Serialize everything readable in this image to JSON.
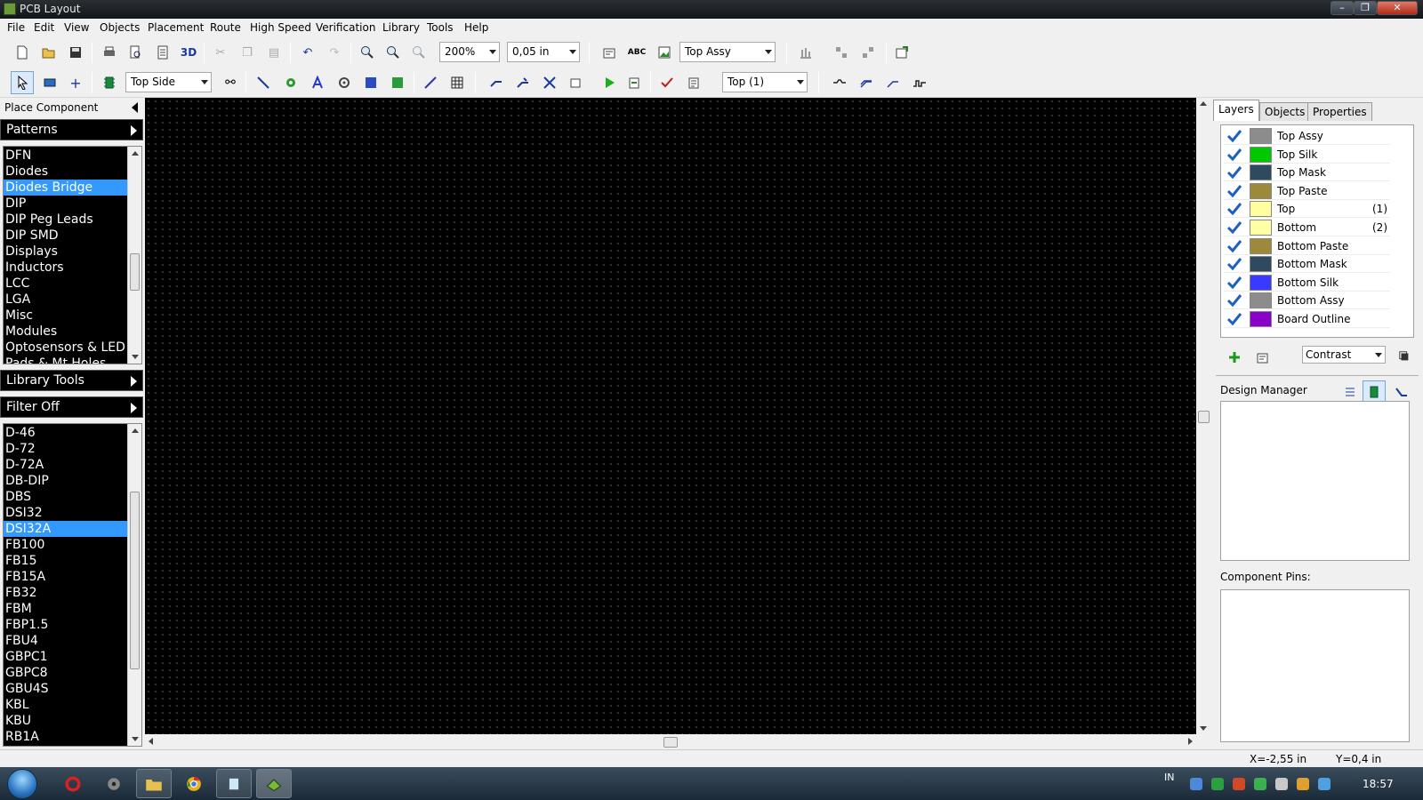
{
  "window": {
    "title": "PCB Layout",
    "min": "–",
    "max": "❐",
    "close": "✕"
  },
  "menu": [
    "File",
    "Edit",
    "View",
    "Objects",
    "Placement",
    "Route",
    "High Speed",
    "Verification",
    "Library",
    "Tools",
    "Help"
  ],
  "toolbar1": {
    "label_3d": "3D",
    "label_abc": "ABC",
    "zoom": "200%",
    "grid": "0,05 in",
    "layer": "Top Assy"
  },
  "toolbar2": {
    "side": "Top Side",
    "route_layer": "Top (1)"
  },
  "left_panel": {
    "place_component": "Place Component",
    "patterns_header": "Patterns",
    "patterns": [
      "DFN",
      "Diodes",
      "Diodes Bridge",
      "DIP",
      "DIP Peg Leads",
      "DIP SMD",
      "Displays",
      "Inductors",
      "LCC",
      "LGA",
      "Misc",
      "Modules",
      "Optosensors & LED",
      "Pads & Mt Holes"
    ],
    "patterns_selected": "Diodes Bridge",
    "library_tools": "Library Tools",
    "filter": "Filter Off",
    "components": [
      "D-46",
      "D-72",
      "D-72A",
      "DB-DIP",
      "DBS",
      "DSI32",
      "DSI32A",
      "FB100",
      "FB15",
      "FB15A",
      "FB32",
      "FBM",
      "FBP1.5",
      "FBU4",
      "GBPC1",
      "GBPC8",
      "GBU4S",
      "KBL",
      "KBU",
      "RB1A"
    ],
    "components_selected": "DSI32A"
  },
  "right_panel": {
    "tabs": [
      "Layers",
      "Objects",
      "Properties"
    ],
    "active_tab": "Layers",
    "layers": [
      {
        "name": "Top Assy",
        "color": "#8c8c8c",
        "num": ""
      },
      {
        "name": "Top Silk",
        "color": "#00c800",
        "num": ""
      },
      {
        "name": "Top Mask",
        "color": "#2e4a5e",
        "num": ""
      },
      {
        "name": "Top Paste",
        "color": "#9c8a3a",
        "num": ""
      },
      {
        "name": "Top",
        "color": "#ffff9e",
        "num": "(1)"
      },
      {
        "name": "Bottom",
        "color": "#ffffa8",
        "num": "(2)"
      },
      {
        "name": "Bottom Paste",
        "color": "#9c8a3a",
        "num": ""
      },
      {
        "name": "Bottom Mask",
        "color": "#2e4a5e",
        "num": ""
      },
      {
        "name": "Bottom Silk",
        "color": "#3a3aff",
        "num": ""
      },
      {
        "name": "Bottom Assy",
        "color": "#8c8c8c",
        "num": ""
      },
      {
        "name": "Board Outline",
        "color": "#8a00c8",
        "num": ""
      }
    ],
    "contrast": "Contrast",
    "design_manager": "Design Manager",
    "component_pins": "Component Pins:"
  },
  "status": {
    "x": "X=-2,55 in",
    "y": "Y=0,4 in"
  },
  "taskbar": {
    "lang": "IN",
    "time": "18:57"
  },
  "colors": {
    "selection": "#3399ff",
    "canvas": "#000000",
    "check": "#1e5fbf"
  }
}
